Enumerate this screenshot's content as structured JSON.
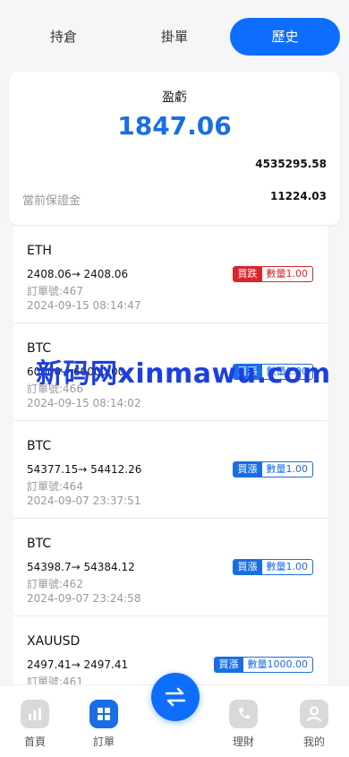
{
  "tabs": [
    {
      "label": "持倉"
    },
    {
      "label": "掛單"
    },
    {
      "label": "歷史",
      "active": true
    }
  ],
  "summary": {
    "label": "盈虧",
    "value": "1847.06",
    "sub_value": "4535295.58",
    "margin_label": "當前保證金",
    "margin_value": "11224.03"
  },
  "orders": [
    {
      "symbol": "ETH",
      "prices": "2408.06→ 2408.06",
      "order_no": "訂單號:467",
      "time": "2024-09-15 08:14:47",
      "direction": "買跌",
      "quantity": "數量1.00"
    },
    {
      "symbol": "BTC",
      "prices": "60000→ 60000.00",
      "order_no": "訂單號:466",
      "time": "2024-09-15 08:14:02",
      "direction": "買漲",
      "quantity": "數量1.00"
    },
    {
      "symbol": "BTC",
      "prices": "54377.15→ 54412.26",
      "order_no": "訂單號:464",
      "time": "2024-09-07 23:37:51",
      "direction": "買漲",
      "quantity": "數量1.00"
    },
    {
      "symbol": "BTC",
      "prices": "54398.7→ 54384.12",
      "order_no": "訂單號:462",
      "time": "2024-09-07 23:24:58",
      "direction": "買漲",
      "quantity": "數量1.00"
    },
    {
      "symbol": "XAUUSD",
      "prices": "2497.41→ 2497.41",
      "order_no": "訂單號:461",
      "time": "",
      "direction": "買漲",
      "quantity": "數量1000.00"
    }
  ],
  "watermark": "新码网xinmawu.com",
  "nav": [
    {
      "label": "首頁",
      "icon": "chart-icon"
    },
    {
      "label": "訂單",
      "icon": "grid-icon",
      "active": true
    },
    {
      "label": "",
      "icon": "swap-icon"
    },
    {
      "label": "理財",
      "icon": "phone-icon"
    },
    {
      "label": "我的",
      "icon": "user-icon"
    }
  ],
  "colors": {
    "accent": "#1a6ee3",
    "sell": "#d9252e",
    "active_tab": "#0d6efd"
  }
}
